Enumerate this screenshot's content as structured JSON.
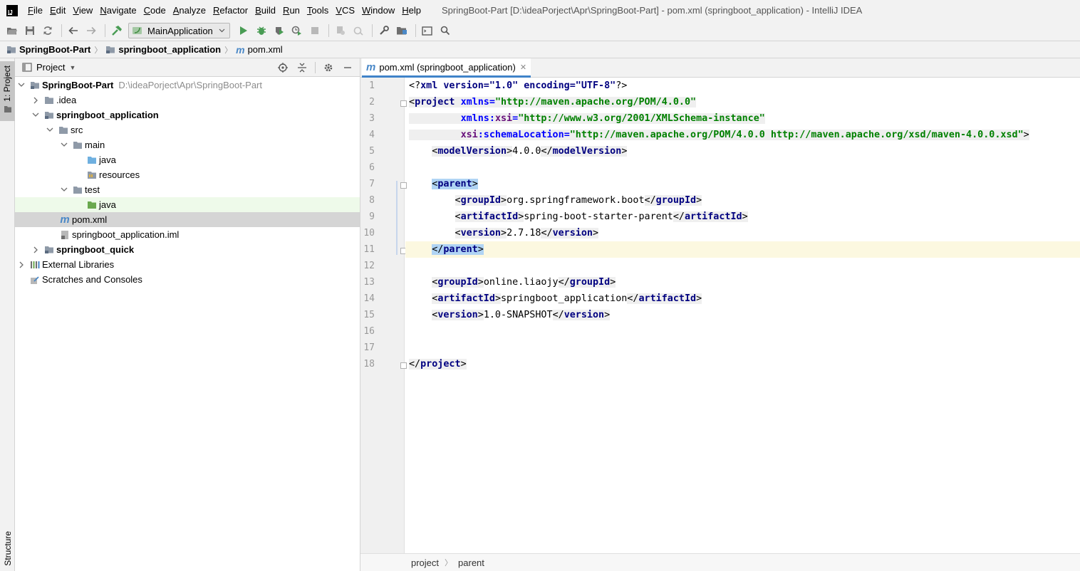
{
  "menubar": {
    "items": [
      "File",
      "Edit",
      "View",
      "Navigate",
      "Code",
      "Analyze",
      "Refactor",
      "Build",
      "Run",
      "Tools",
      "VCS",
      "Window",
      "Help"
    ],
    "window_title": "SpringBoot-Part [D:\\ideaPorject\\Apr\\SpringBoot-Part] - pom.xml (springboot_application) - IntelliJ IDEA"
  },
  "toolbar": {
    "run_config": "MainApplication"
  },
  "breadcrumb": {
    "items": [
      "SpringBoot-Part",
      "springboot_application",
      "pom.xml"
    ]
  },
  "left_stripe": {
    "project_tab": "1: Project",
    "structure_tab": "Structure"
  },
  "project_panel": {
    "title": "Project",
    "tree": [
      {
        "label": "SpringBoot-Part",
        "hint": "D:\\ideaPorject\\Apr\\SpringBoot-Part",
        "bold": true
      },
      {
        "label": ".idea"
      },
      {
        "label": "springboot_application",
        "bold": true
      },
      {
        "label": "src"
      },
      {
        "label": "main"
      },
      {
        "label": "java"
      },
      {
        "label": "resources"
      },
      {
        "label": "test"
      },
      {
        "label": "java"
      },
      {
        "label": "pom.xml"
      },
      {
        "label": "springboot_application.iml"
      },
      {
        "label": "springboot_quick",
        "bold": true
      },
      {
        "label": "External Libraries"
      },
      {
        "label": "Scratches and Consoles"
      }
    ]
  },
  "editor": {
    "tab_label": "pom.xml (springboot_application)",
    "line_numbers": [
      "1",
      "2",
      "3",
      "4",
      "5",
      "6",
      "7",
      "8",
      "9",
      "10",
      "11",
      "12",
      "13",
      "14",
      "15",
      "16",
      "17",
      "18"
    ],
    "footer": [
      "project",
      "parent"
    ],
    "code": {
      "l1_decl": "xml version=\"1.0\" encoding=\"UTF-8\"",
      "project_tag": "project",
      "xmlns_attr": "xmlns",
      "xmlns_val": "\"http://maven.apache.org/POM/4.0.0\"",
      "xsi_prefix": "xmlns:",
      "xsi_attr": "xsi",
      "xsi_val": "\"http://www.w3.org/2001/XMLSchema-instance\"",
      "schema_prefix": "xsi",
      "schema_attr": ":schemaLocation",
      "schema_val": "\"http://maven.apache.org/POM/4.0.0 http://maven.apache.org/xsd/maven-4.0.0.xsd\"",
      "modelVersion_tag": "modelVersion",
      "modelVersion_val": "4.0.0",
      "parent_tag": "parent",
      "groupId_tag": "groupId",
      "parent_groupId": "org.springframework.boot",
      "artifactId_tag": "artifactId",
      "parent_artifactId": "spring-boot-starter-parent",
      "version_tag": "version",
      "parent_version": "2.7.18",
      "groupId": "online.liaojy",
      "artifactId": "springboot_application",
      "version": "1.0-SNAPSHOT"
    }
  },
  "colors": {
    "selection": "#d5d5d5",
    "tag": "#000080",
    "attr": "#0000ff",
    "string": "#008000",
    "tab_underline": "#4083c9"
  }
}
